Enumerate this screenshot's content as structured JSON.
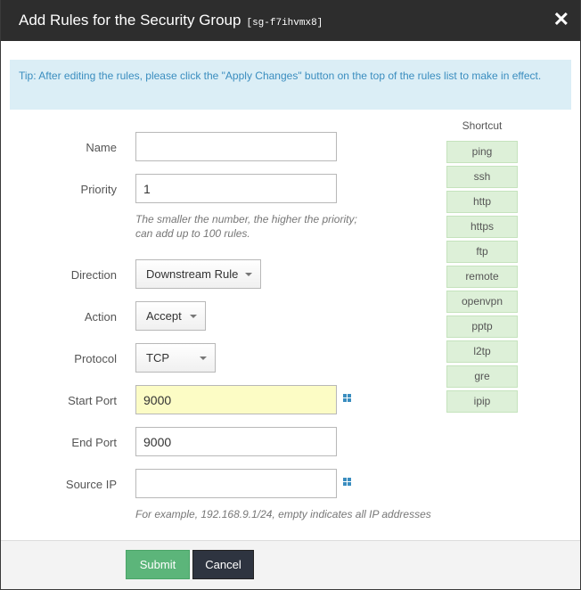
{
  "dialog": {
    "title": "Add Rules for the Security Group",
    "group_id": "[sg-f7ihvmx8]",
    "close_icon": "close-icon"
  },
  "tip": "Tip: After editing the rules, please click the \"Apply Changes\" button on the top of the rules list to make in effect.",
  "form": {
    "name": {
      "label": "Name",
      "value": ""
    },
    "priority": {
      "label": "Priority",
      "value": "1",
      "hint_line1": "The smaller the number, the higher the priority;",
      "hint_line2": "can add up to 100 rules."
    },
    "direction": {
      "label": "Direction",
      "value": "Downstream Rule"
    },
    "action": {
      "label": "Action",
      "value": "Accept"
    },
    "protocol": {
      "label": "Protocol",
      "value": "TCP"
    },
    "start_port": {
      "label": "Start Port",
      "value": "9000"
    },
    "end_port": {
      "label": "End Port",
      "value": "9000"
    },
    "source_ip": {
      "label": "Source IP",
      "value": "",
      "hint": "For example, 192.168.9.1/24, empty indicates all IP addresses"
    }
  },
  "shortcut": {
    "title": "Shortcut",
    "items": [
      "ping",
      "ssh",
      "http",
      "https",
      "ftp",
      "remote",
      "openvpn",
      "pptp",
      "l2tp",
      "gre",
      "ipip"
    ]
  },
  "footer": {
    "submit": "Submit",
    "cancel": "Cancel"
  },
  "colors": {
    "header_bg": "#2d2d2d",
    "tip_bg": "#dbeef6",
    "shortcut_bg": "#ddf0d8",
    "submit_bg": "#5cb57a",
    "highlight_field": "#fcfcc5"
  }
}
